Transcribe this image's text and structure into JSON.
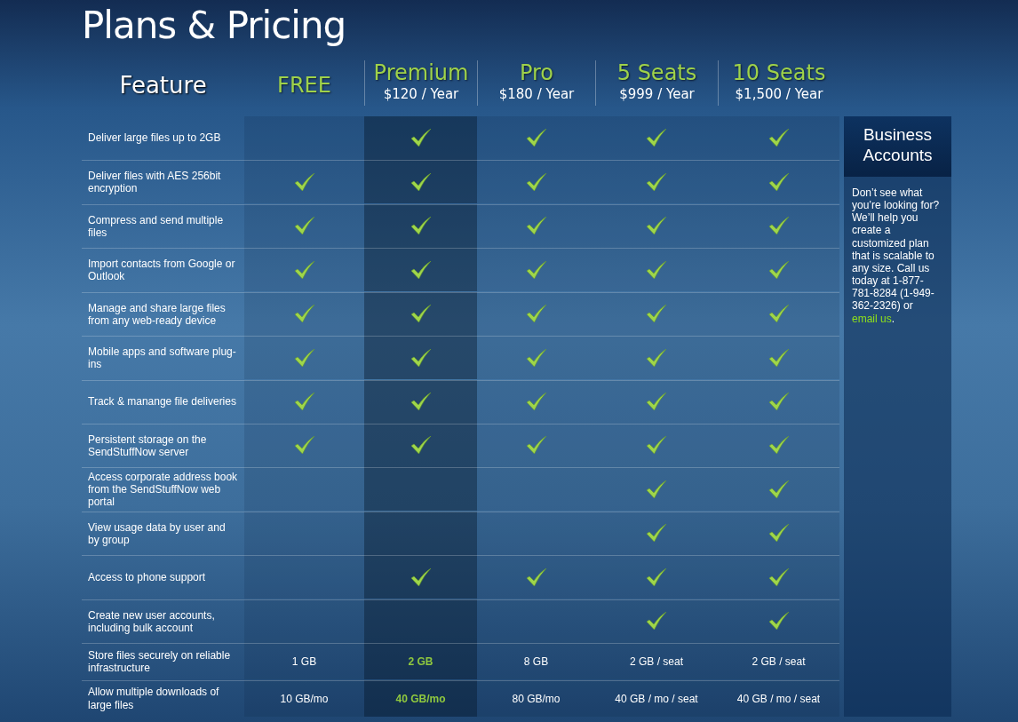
{
  "title": "Plans & Pricing",
  "feature_heading": "Feature",
  "plans": [
    {
      "name": "FREE",
      "selected": false
    },
    {
      "name": "Premium",
      "price": "$120 / Year",
      "selected": true
    },
    {
      "name": "Pro",
      "price": "$180 / Year",
      "selected": false
    },
    {
      "name": "5 Seats",
      "price": "$999 / Year",
      "selected": false
    },
    {
      "name": "10 Seats",
      "price": "$1,500 / Year",
      "selected": false
    }
  ],
  "rows": [
    {
      "feature": "Deliver large files up to 2GB",
      "cells": [
        {
          "kind": "check",
          "checked": false
        },
        {
          "kind": "check",
          "checked": true
        },
        {
          "kind": "check",
          "checked": true
        },
        {
          "kind": "check",
          "checked": true
        },
        {
          "kind": "check",
          "checked": true
        }
      ]
    },
    {
      "feature": "Deliver files with AES 256bit encryption",
      "cells": [
        {
          "kind": "check",
          "checked": true
        },
        {
          "kind": "check",
          "checked": true
        },
        {
          "kind": "check",
          "checked": true
        },
        {
          "kind": "check",
          "checked": true
        },
        {
          "kind": "check",
          "checked": true
        }
      ]
    },
    {
      "feature": "Compress and send multiple files",
      "cells": [
        {
          "kind": "check",
          "checked": true
        },
        {
          "kind": "check",
          "checked": true
        },
        {
          "kind": "check",
          "checked": true
        },
        {
          "kind": "check",
          "checked": true
        },
        {
          "kind": "check",
          "checked": true
        }
      ]
    },
    {
      "feature": "Import contacts from Google or Outlook",
      "cells": [
        {
          "kind": "check",
          "checked": true
        },
        {
          "kind": "check",
          "checked": true
        },
        {
          "kind": "check",
          "checked": true
        },
        {
          "kind": "check",
          "checked": true
        },
        {
          "kind": "check",
          "checked": true
        }
      ]
    },
    {
      "feature": "Manage and share large files from any web-ready device",
      "cells": [
        {
          "kind": "check",
          "checked": true
        },
        {
          "kind": "check",
          "checked": true
        },
        {
          "kind": "check",
          "checked": true
        },
        {
          "kind": "check",
          "checked": true
        },
        {
          "kind": "check",
          "checked": true
        }
      ]
    },
    {
      "feature": "Mobile apps and software plug-ins",
      "cells": [
        {
          "kind": "check",
          "checked": true
        },
        {
          "kind": "check",
          "checked": true
        },
        {
          "kind": "check",
          "checked": true
        },
        {
          "kind": "check",
          "checked": true
        },
        {
          "kind": "check",
          "checked": true
        }
      ]
    },
    {
      "feature": "Track & manange file deliveries",
      "cells": [
        {
          "kind": "check",
          "checked": true
        },
        {
          "kind": "check",
          "checked": true
        },
        {
          "kind": "check",
          "checked": true
        },
        {
          "kind": "check",
          "checked": true
        },
        {
          "kind": "check",
          "checked": true
        }
      ]
    },
    {
      "feature": "Persistent storage on the SendStuffNow server",
      "cells": [
        {
          "kind": "check",
          "checked": true
        },
        {
          "kind": "check",
          "checked": true
        },
        {
          "kind": "check",
          "checked": true
        },
        {
          "kind": "check",
          "checked": true
        },
        {
          "kind": "check",
          "checked": true
        }
      ]
    },
    {
      "feature": "Access corporate address book from the SendStuffNow web portal",
      "cells": [
        {
          "kind": "check",
          "checked": false
        },
        {
          "kind": "check",
          "checked": false
        },
        {
          "kind": "check",
          "checked": false
        },
        {
          "kind": "check",
          "checked": true
        },
        {
          "kind": "check",
          "checked": true
        }
      ]
    },
    {
      "feature": "View usage data by user and by group",
      "cells": [
        {
          "kind": "check",
          "checked": false
        },
        {
          "kind": "check",
          "checked": false
        },
        {
          "kind": "check",
          "checked": false
        },
        {
          "kind": "check",
          "checked": true
        },
        {
          "kind": "check",
          "checked": true
        }
      ]
    },
    {
      "feature": "Access to phone support",
      "cells": [
        {
          "kind": "check",
          "checked": false
        },
        {
          "kind": "check",
          "checked": true
        },
        {
          "kind": "check",
          "checked": true
        },
        {
          "kind": "check",
          "checked": true
        },
        {
          "kind": "check",
          "checked": true
        }
      ]
    },
    {
      "feature": "Create new user accounts, including bulk account",
      "cells": [
        {
          "kind": "check",
          "checked": false
        },
        {
          "kind": "check",
          "checked": false
        },
        {
          "kind": "check",
          "checked": false
        },
        {
          "kind": "check",
          "checked": true
        },
        {
          "kind": "check",
          "checked": true
        }
      ]
    },
    {
      "feature": "Store files securely on reliable infrastructure",
      "cells": [
        {
          "kind": "text",
          "text": "1 GB"
        },
        {
          "kind": "text",
          "text": "2 GB"
        },
        {
          "kind": "text",
          "text": "8 GB"
        },
        {
          "kind": "text",
          "text": "2 GB / seat"
        },
        {
          "kind": "text",
          "text": "2 GB / seat"
        }
      ]
    },
    {
      "feature": "Allow multiple downloads of large files",
      "cells": [
        {
          "kind": "text",
          "text": "10 GB/mo"
        },
        {
          "kind": "text",
          "text": "40 GB/mo"
        },
        {
          "kind": "text",
          "text": "80 GB/mo"
        },
        {
          "kind": "text",
          "text": "40 GB / mo / seat"
        },
        {
          "kind": "text",
          "text": "40 GB / mo / seat"
        }
      ]
    }
  ],
  "business": {
    "title": "Business Accounts",
    "text": "Don’t see what you’re looking for? We’ll help you create a customized plan that is scalable to any size. Call us today at 1-877-781-8284 (1-949-362-2326) or",
    "link": "email us",
    "after": "."
  }
}
